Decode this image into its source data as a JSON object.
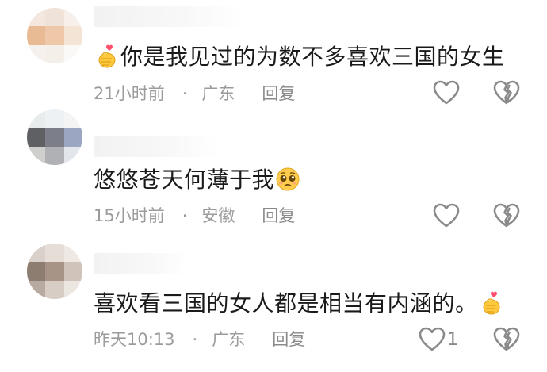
{
  "comments": [
    {
      "text": "你是我见过的为数不多喜欢三国的女生",
      "leading_emoji": "finger-heart-emoji",
      "trailing_emoji": null,
      "time": "21小时前",
      "separator": "·",
      "location": "广东",
      "reply_label": "回复",
      "like_count": "",
      "avatar_colors": [
        "#f3e7df",
        "#efe2d9",
        "#f7f0ea",
        "#e9bb95",
        "#eec8a8",
        "#f4e4d6",
        "#f6f1ec",
        "#f5efe9",
        "#fbf9f7"
      ]
    },
    {
      "text": "悠悠苍天何薄于我",
      "leading_emoji": null,
      "trailing_emoji": "pleading-face-emoji",
      "time": "15小时前",
      "separator": "·",
      "location": "安徽",
      "reply_label": "回复",
      "like_count": "",
      "avatar_colors": [
        "#e8ecec",
        "#eef1f3",
        "#f4f4f4",
        "#5f6064",
        "#7c7f8a",
        "#9aa6c2",
        "#cfcfcd",
        "#b0b1b5",
        "#e3e6ea"
      ]
    },
    {
      "text": "喜欢看三国的女人都是相当有内涵的。",
      "leading_emoji": null,
      "trailing_emoji": "finger-heart-emoji",
      "time": "昨天10:13",
      "separator": "·",
      "location": "广东",
      "reply_label": "回复",
      "like_count": "1",
      "avatar_colors": [
        "#d9d0c9",
        "#e6ddd6",
        "#efe8e3",
        "#8d7d70",
        "#a89487",
        "#cfc3ba",
        "#b6aaa1",
        "#d7cdc5",
        "#ece6e1"
      ]
    }
  ],
  "colors": {
    "text": "#1a1a1a",
    "meta": "#9b9b9b",
    "icon": "#8a8a8a"
  }
}
